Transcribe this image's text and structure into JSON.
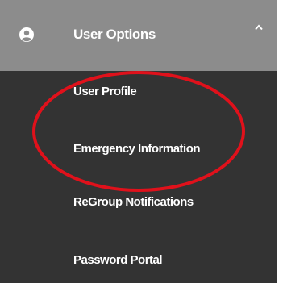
{
  "header": {
    "label": "User Options",
    "icon": "user-circle-icon",
    "chevron": "chevron-up-icon",
    "background": "#8c8c8c"
  },
  "submenu": {
    "background": "#333333",
    "items": [
      {
        "label": "User Profile"
      },
      {
        "label": "Emergency Information"
      },
      {
        "label": "ReGroup Notifications"
      },
      {
        "label": "Password Portal"
      }
    ]
  },
  "annotation": {
    "shape": "ellipse",
    "color": "#e0111b"
  }
}
